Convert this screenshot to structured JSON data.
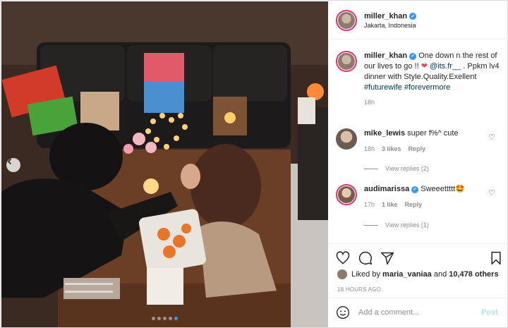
{
  "header": {
    "username": "miller_khan",
    "location": "Jakarta, Indonesia"
  },
  "caption": {
    "username": "miller_khan",
    "text_1": "One down n the rest of our lives to go !!",
    "mention": "@its.fr__",
    "text_2": ". Ppkm lv4 dinner with Style.Quality.Exellent",
    "hashtag_1": "#futurewife",
    "hashtag_2": "#forevermore",
    "time": "18h"
  },
  "comments": [
    {
      "username": "mike_lewis",
      "text": "super f%^ cute",
      "time": "18h",
      "likes": "3 likes",
      "reply": "Reply",
      "view_replies": "View replies (2)"
    },
    {
      "username": "audimarissa",
      "text": "Sweeettttt",
      "emoji": "🤩",
      "time": "17h",
      "likes": "1 like",
      "reply": "Reply",
      "view_replies": "View replies (1)"
    }
  ],
  "likes": {
    "prefix": "Liked by",
    "user": "maria_vaniaa",
    "middle": "and",
    "count": "10,478 others"
  },
  "posted_ago": "18 HOURS AGO",
  "add_comment": {
    "placeholder": "Add a comment...",
    "post_label": "Post"
  },
  "carousel": {
    "total": 5,
    "active_index": 4
  },
  "colors": {
    "accent": "#3897f0",
    "link": "#00376b",
    "heart": "#ed4956"
  }
}
